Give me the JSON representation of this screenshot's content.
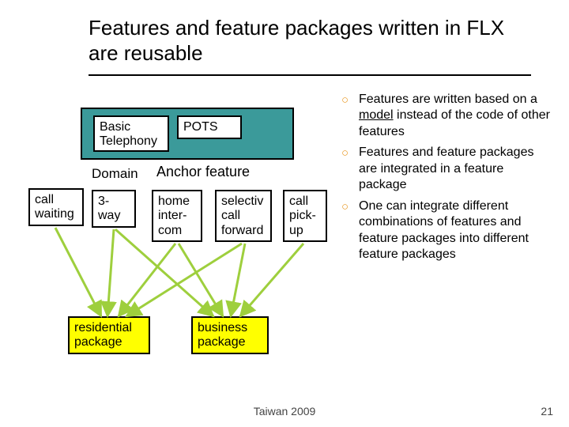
{
  "title": "Features and feature packages written in FLX are reusable",
  "diagram": {
    "basic_telephony": "Basic\nTelephony",
    "pots": "POTS",
    "domain_label": "Domain",
    "anchor_label": "Anchor feature",
    "call_waiting": "call\nwaiting",
    "three_way": "3-\nway",
    "home_intercom": "home\ninter-\ncom",
    "selective_call_forward": "selectiv\ncall\nforward",
    "call_pickup": "call\npick-\nup",
    "residential_package": "residential\npackage",
    "business_package": "business\npackage"
  },
  "bullets": {
    "b1a": "Features are written based on a ",
    "b1_model": "model",
    "b1b": " instead of the code of other features",
    "b2": "Features and feature packages are integrated in a feature package",
    "b3": "One can integrate different combinations of features and feature packages into different feature packages"
  },
  "footer": {
    "center": "Taiwan 2009",
    "page": "21"
  }
}
